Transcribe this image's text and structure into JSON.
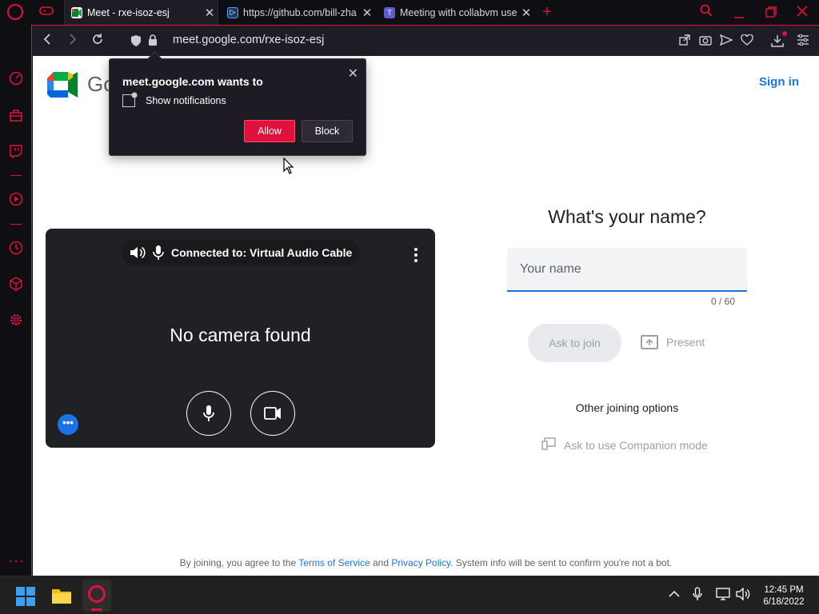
{
  "browser": {
    "tabs": [
      {
        "title": "Meet - rxe-isoz-esj",
        "active": true
      },
      {
        "title": "https://github.com/bill-zha",
        "active": false
      },
      {
        "title": "Meeting with collabvm use",
        "active": false
      }
    ],
    "url": "meet.google.com/rxe-isoz-esj",
    "accent": "#e0123b"
  },
  "meet": {
    "brand_partial": "Go",
    "sign_in": "Sign in",
    "preview": {
      "audio_status": "Connected to: Virtual Audio Cable",
      "no_camera": "No camera found"
    },
    "join": {
      "heading": "What's your name?",
      "name_placeholder": "Your name",
      "name_value": "",
      "counter": "0 / 60",
      "ask_to_join": "Ask to join",
      "present": "Present",
      "other_options": "Other joining options",
      "companion": "Ask to use Companion mode"
    },
    "footer": {
      "prefix": "By joining, you agree to the",
      "terms": "Terms of Service",
      "and": "and",
      "privacy": "Privacy Policy",
      "suffix": ". System info will be sent to confirm you're not a bot."
    }
  },
  "permission_popup": {
    "title": "meet.google.com wants to",
    "permission": "Show notifications",
    "allow": "Allow",
    "block": "Block"
  },
  "taskbar": {
    "time": "12:45 PM",
    "date": "6/18/2022"
  }
}
